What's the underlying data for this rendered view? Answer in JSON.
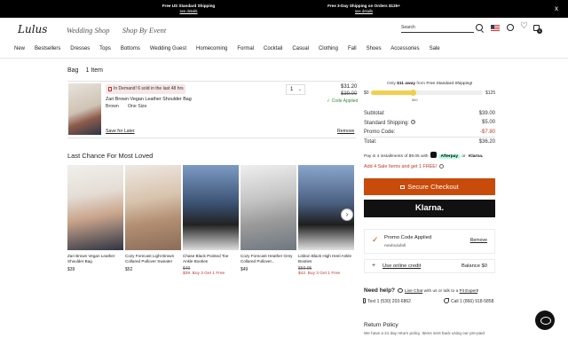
{
  "promo_bar": {
    "left_title": "Free US Standard Shipping",
    "left_sub": "see details",
    "right_title": "Free 3-Day Shipping on Orders $125+",
    "right_sub": "see details",
    "close": "x"
  },
  "header": {
    "logo": "Lulus",
    "links": [
      "Wedding Shop",
      "Shop By Event"
    ],
    "search_placeholder": "Search",
    "bag_count": "1"
  },
  "nav": [
    "New",
    "Bestsellers",
    "Dresses",
    "Tops",
    "Bottoms",
    "Wedding Guest",
    "Homecoming",
    "Formal",
    "Cocktail",
    "Casual",
    "Clothing",
    "Fall",
    "Shoes",
    "Accessories",
    "Sale"
  ],
  "bag": {
    "title": "Bag",
    "count": "1 Item",
    "item": {
      "demand": "In Demand! 6 sold in the last 48 hrs",
      "name": "Zari Brown Vegan Leather Shoulder Bag",
      "color": "Brown",
      "size": "One Size",
      "qty": "1",
      "price": "$31.20",
      "old_price": "$39.00",
      "code_applied": "✓ Code Applied",
      "save_later": "Save for Later",
      "remove": "Remove"
    }
  },
  "last_chance": {
    "title": "Last Chance For Most Loved",
    "products": [
      {
        "name": "Zari Brown Vegan Leather Shoulder Bag",
        "price": "$39",
        "old": "",
        "deal": "",
        "color": "#c9a48b"
      },
      {
        "name": "Cozy Forecast Light Brown Collared Pullover Sweater",
        "price": "$52",
        "old": "",
        "deal": "",
        "color": "#b38f73"
      },
      {
        "name": "Chase Black Pointed Toe Ankle Booties",
        "price": "",
        "old": "$49",
        "deal": "$39. Buy 3 Get 1 Free",
        "color": "#3b5273"
      },
      {
        "name": "Cozy Forecast Heather Grey Collared Pullover...",
        "price": "$49",
        "old": "",
        "deal": "",
        "color": "#9a9a9a"
      },
      {
        "name": "Lisbon Black High Heel Ankle Booties",
        "price": "",
        "old": "$59.95",
        "deal": "$42. Buy 3 Get 1 Free",
        "color": "#4a5f80"
      }
    ]
  },
  "shipping": {
    "prefix": "Only",
    "amount": "$11 away",
    "middle": "from",
    "free": "Free Standard Shipping!",
    "lo": "$0",
    "hi": "$125",
    "mid": "$50",
    "progress": 0.37
  },
  "summary": {
    "subtotal_label": "Subtotal:",
    "subtotal": "$39.00",
    "shipping_label": "Standard Shipping:",
    "shipping": "$5.00",
    "promo_label": "Promo Code:",
    "promo": "-$7.80",
    "total_label": "Total:",
    "total": "$36.20"
  },
  "afterpay": {
    "text": "Pay in 4 installments of $9.05 with",
    "badge": "Afterpay",
    "or": "or",
    "klarna": "Klarna."
  },
  "add_sale": "Add 4 Sale Items and get 1 FREE!",
  "checkout": "Secure Checkout",
  "klarna_btn": "Klarna.",
  "promo_box": {
    "applied": "Promo Code Applied",
    "code": "newloulufall",
    "remove": "Remove"
  },
  "credit": {
    "link": "Use online credit",
    "balance": "Balance $0"
  },
  "help": {
    "title": "Need help?",
    "chat_link": "Live Chat",
    "chat_mid": "with us or talk to a",
    "expert_link": "Fit Expert",
    "chat_end": "!",
    "text_label": "Text",
    "text_num": "1 (530) 203-6862",
    "call_label": "Call",
    "call_num": "1 (866) 918-5858"
  },
  "returns": {
    "title": "Return Policy",
    "text": "We have a 21 day return policy. Items sent back using our pre-paid"
  }
}
